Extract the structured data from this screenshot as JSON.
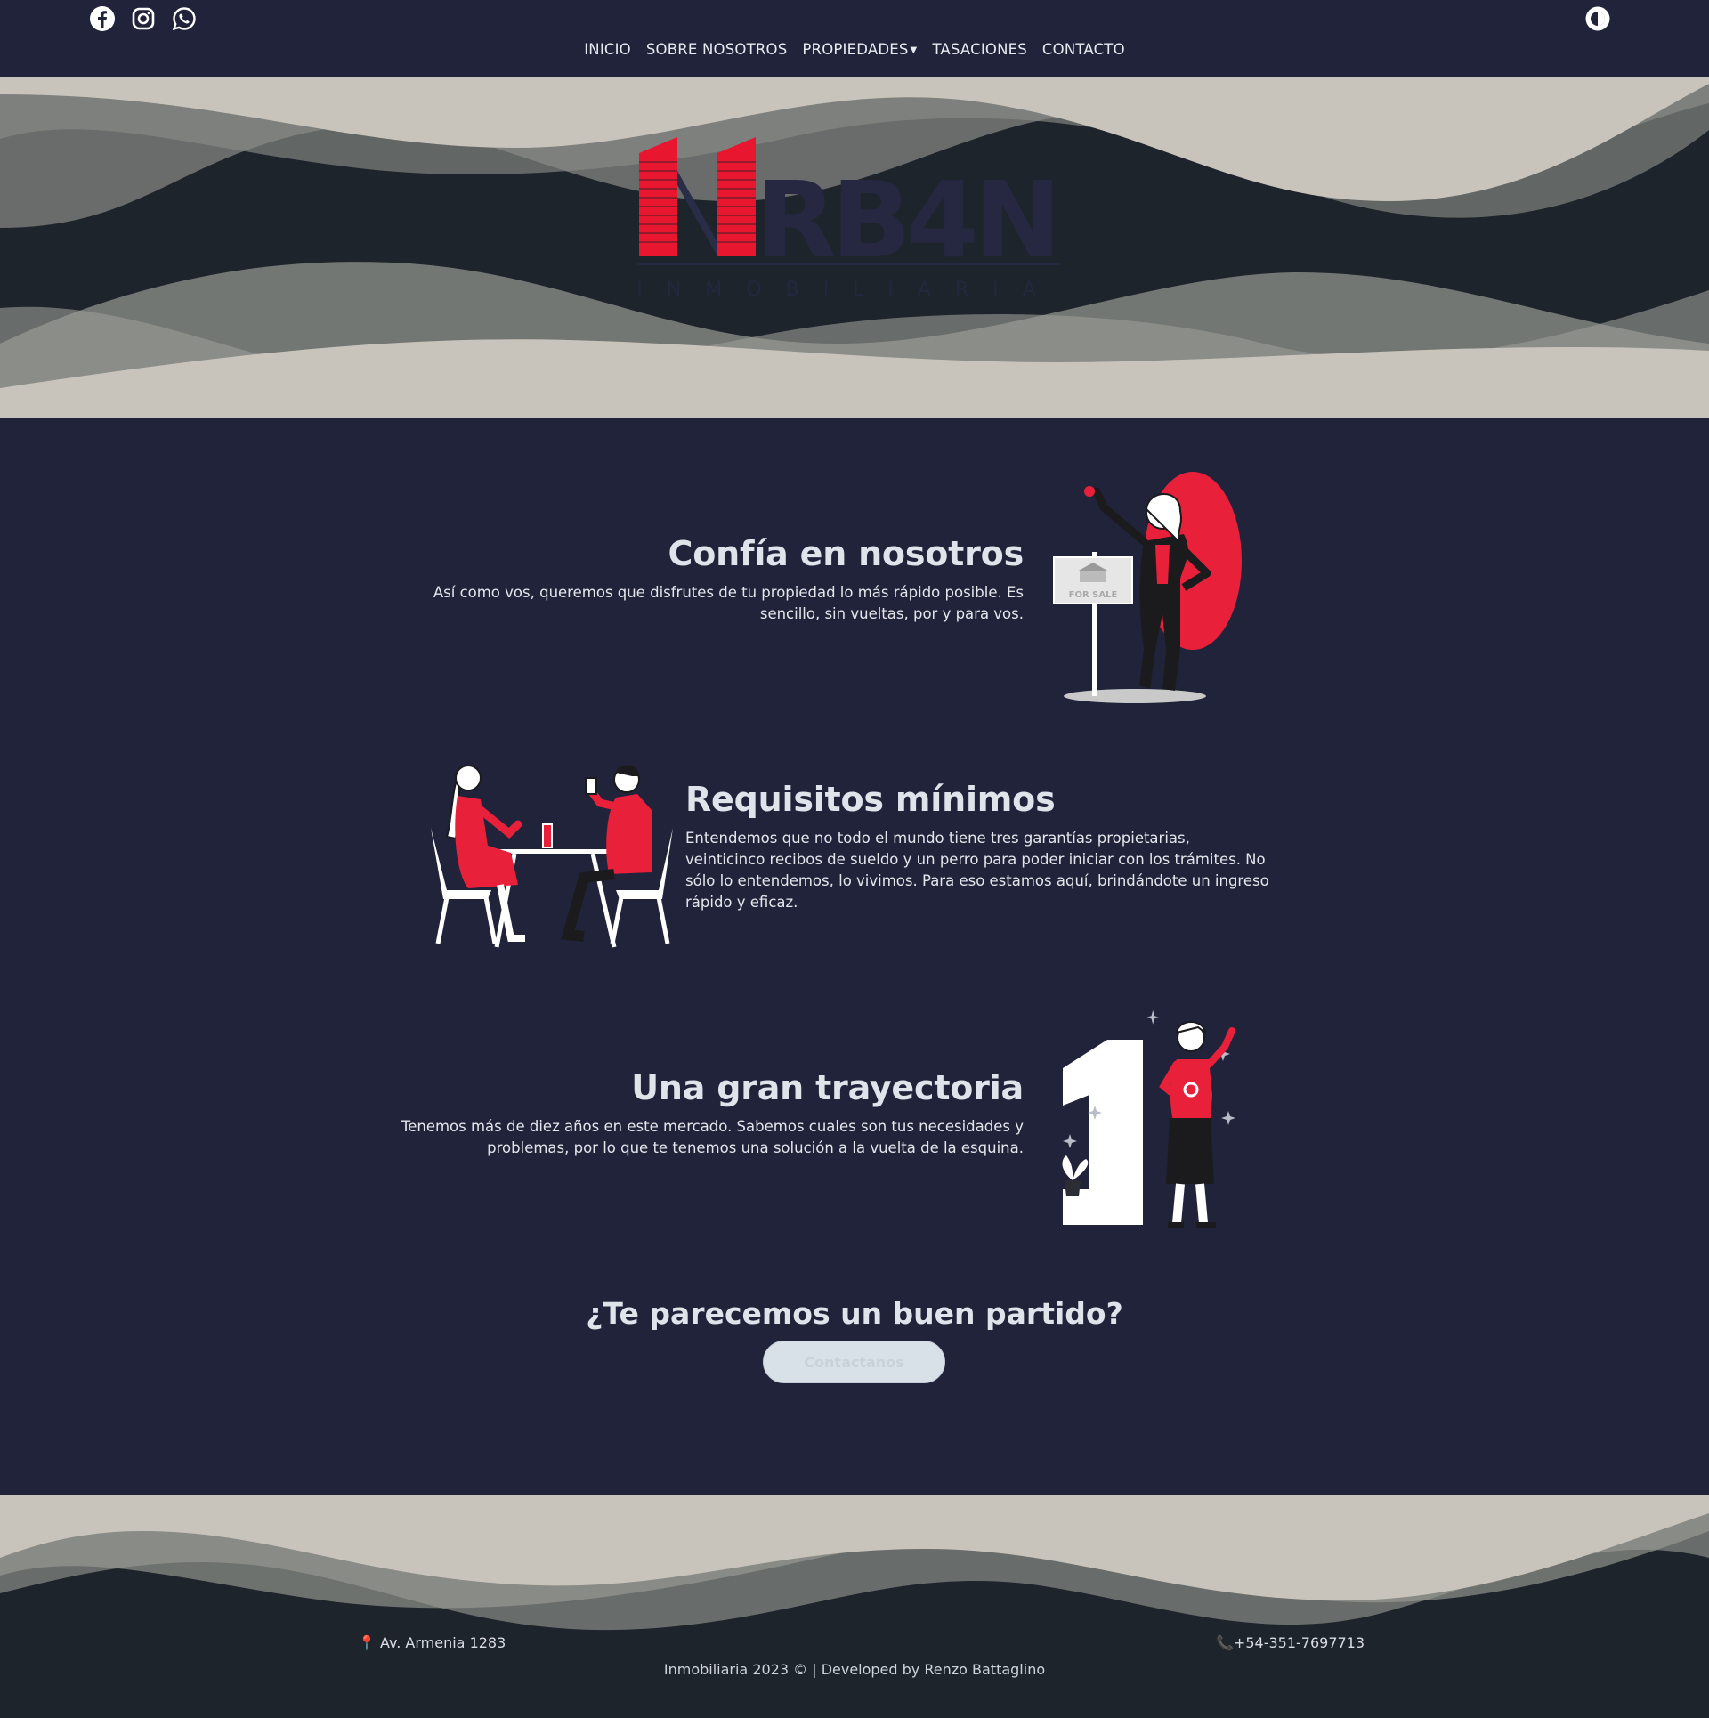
{
  "nav": {
    "items": [
      {
        "label": "INICIO",
        "name": "nav-inicio"
      },
      {
        "label": "SOBRE NOSOTROS",
        "name": "nav-sobre-nosotros"
      },
      {
        "label": "PROPIEDADES",
        "name": "nav-propiedades",
        "dropdown": true
      },
      {
        "label": "TASACIONES",
        "name": "nav-tasaciones"
      },
      {
        "label": "CONTACTO",
        "name": "nav-contacto"
      }
    ]
  },
  "social": [
    "facebook-icon",
    "instagram-icon",
    "whatsapp-icon"
  ],
  "theme_toggle_icon": "contrast-icon",
  "logo": {
    "wordmark": "RB4N",
    "tagline": "INMOBILIARIA"
  },
  "features": [
    {
      "title": "Confía en nosotros",
      "text": "Así como vos, queremos que disfrutes de tu propiedad lo más rápido posible. Es sencillo, sin vueltas, por y para vos.",
      "sign_text": "FOR SALE"
    },
    {
      "title": "Requisitos mínimos",
      "text": "Entendemos que no todo el mundo tiene tres garantías propietarias, veinticinco recibos de sueldo y un perro para poder iniciar con los trámites. No sólo lo entendemos, lo vivimos. Para eso estamos aquí, brindándote un ingreso rápido y eficaz."
    },
    {
      "title": "Una gran trayectoria",
      "text": "Tenemos más de diez años en este mercado. Sabemos cuales son tus necesidades y problemas, por lo que te tenemos una solución a la vuelta de la esquina."
    }
  ],
  "cta": {
    "title": "¿Te parecemos un buen partido?",
    "button": "Contactanos"
  },
  "footer": {
    "address": "Av. Armenia 1283",
    "phone": "+54-351-7697713",
    "copyright": "Inmobiliaria 2023 © | Developed by Renzo Battaglino"
  },
  "colors": {
    "brand_red": "#e8162f",
    "navy": "#21233a",
    "sand": "#c9c4bb",
    "wave_grey": "#8b8d88",
    "dark_teal": "#1d242b"
  }
}
